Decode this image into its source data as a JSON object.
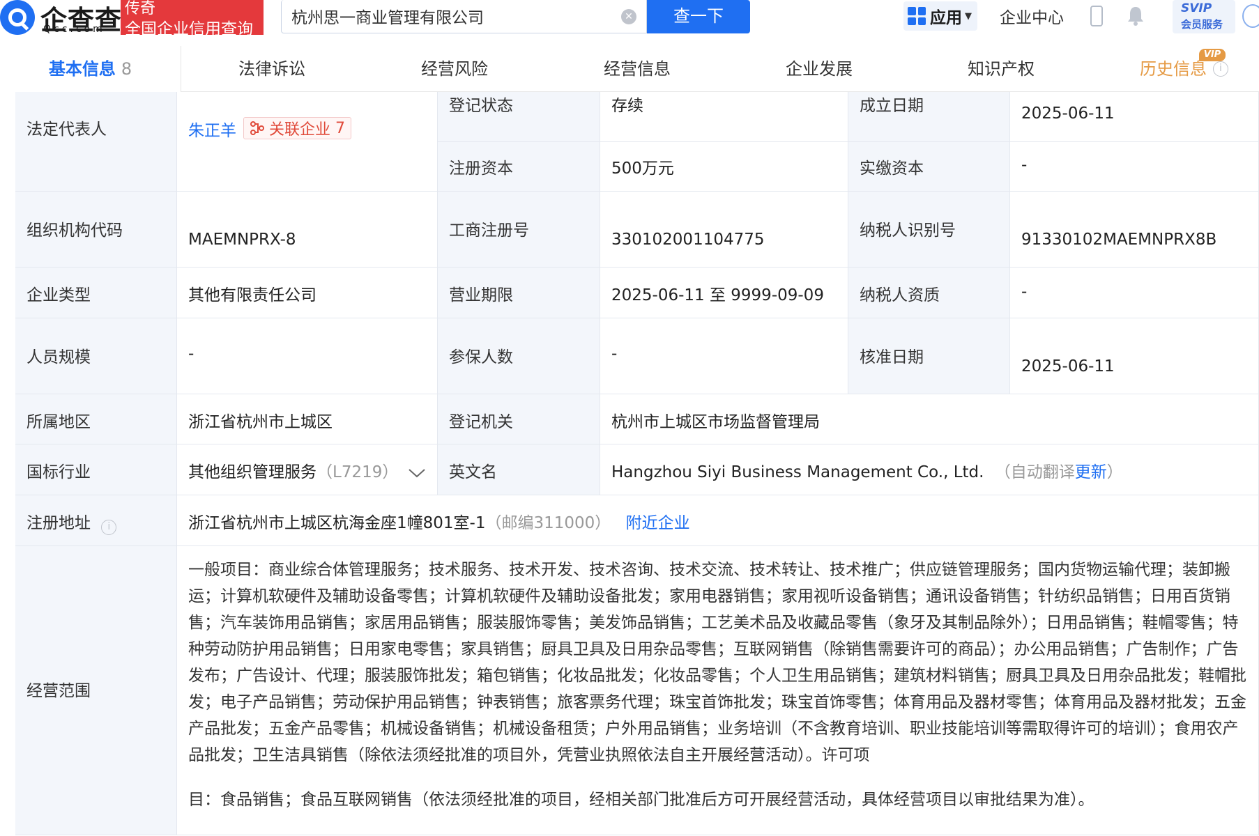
{
  "header": {
    "logo_cn": "企查查",
    "logo_en": "Qcc.com",
    "tag_line1": "传奇",
    "tag_line2": "全国企业信用查询",
    "search_value": "杭州思一商业管理有限公司",
    "search_button": "查一下",
    "app_label": "应用",
    "enterprise_center": "企业中心",
    "svip_line1": "SVIP",
    "svip_line2": "会员服务"
  },
  "tabs": {
    "basic": "基本信息",
    "basic_count": "8",
    "legal": "法律诉讼",
    "risk": "经营风险",
    "operation": "经营信息",
    "development": "企业发展",
    "ip": "知识产权",
    "history": "历史信息",
    "vip": "VIP"
  },
  "info": {
    "legal_rep_label": "法定代表人",
    "legal_rep_name": "朱正羊",
    "related_label": "关联企业",
    "related_count": "7",
    "reg_status_label": "登记状态",
    "reg_status": "存续",
    "found_date_label": "成立日期",
    "found_date": "2025-06-11",
    "reg_capital_label": "注册资本",
    "reg_capital": "500万元",
    "paid_capital_label": "实缴资本",
    "paid_capital": "-",
    "org_code_label": "组织机构代码",
    "org_code": "MAEMNPRX-8",
    "biz_reg_no_label": "工商注册号",
    "biz_reg_no": "330102001104775",
    "taxpayer_id_label": "纳税人识别号",
    "taxpayer_id": "91330102MAEMNPRX8B",
    "company_type_label": "企业类型",
    "company_type": "其他有限责任公司",
    "biz_term_label": "营业期限",
    "biz_term": "2025-06-11 至 9999-09-09",
    "taxpayer_qual_label": "纳税人资质",
    "taxpayer_qual": "-",
    "staff_size_label": "人员规模",
    "staff_size": "-",
    "insured_label": "参保人数",
    "insured": "-",
    "approve_date_label": "核准日期",
    "approve_date": "2025-06-11",
    "region_label": "所属地区",
    "region": "浙江省杭州市上城区",
    "reg_authority_label": "登记机关",
    "reg_authority": "杭州市上城区市场监督管理局",
    "industry_label": "国标行业",
    "industry": "其他组织管理服务",
    "industry_code": "（L7219）",
    "english_name_label": "英文名",
    "english_name": "Hangzhou Siyi Business Management Co., Ltd.",
    "auto_translate": "（自动翻译",
    "update_link": "更新",
    "close_paren": "）",
    "address_label": "注册地址",
    "address": "浙江省杭州市上城区杭海金座1幢801室-1",
    "postcode": "（邮编311000）",
    "nearby_link": "附近企业",
    "scope_label": "经营范围",
    "scope_text": "一般项目：商业综合体管理服务；技术服务、技术开发、技术咨询、技术交流、技术转让、技术推广；供应链管理服务；国内货物运输代理；装卸搬运；计算机软硬件及辅助设备零售；计算机软硬件及辅助设备批发；家用电器销售；家用视听设备销售；通讯设备销售；针纺织品销售；日用百货销售；汽车装饰用品销售；家居用品销售；服装服饰零售；美发饰品销售；工艺美术品及收藏品零售（象牙及其制品除外）；日用品销售；鞋帽零售；特种劳动防护用品销售；日用家电零售；家具销售；厨具卫具及日用杂品零售；互联网销售（除销售需要许可的商品）；办公用品销售；广告制作；广告发布；广告设计、代理；服装服饰批发；箱包销售；化妆品批发；化妆品零售；个人卫生用品销售；建筑材料销售；厨具卫具及日用杂品批发；鞋帽批发；电子产品销售；劳动保护用品销售；钟表销售；旅客票务代理；珠宝首饰批发；珠宝首饰零售；体育用品及器材零售；体育用品及器材批发；五金产品批发；五金产品零售；机械设备销售；机械设备租赁；户外用品销售；业务培训（不含教育培训、职业技能培训等需取得许可的培训）；食用农产品批发；卫生洁具销售（除依法须经批准的项目外，凭营业执照依法自主开展经营活动）。许可项",
    "scope_text2": "目：食品销售；食品互联网销售（依法须经批准的项目，经相关部门批准后方可开展经营活动，具体经营项目以审批结果为准）。"
  }
}
